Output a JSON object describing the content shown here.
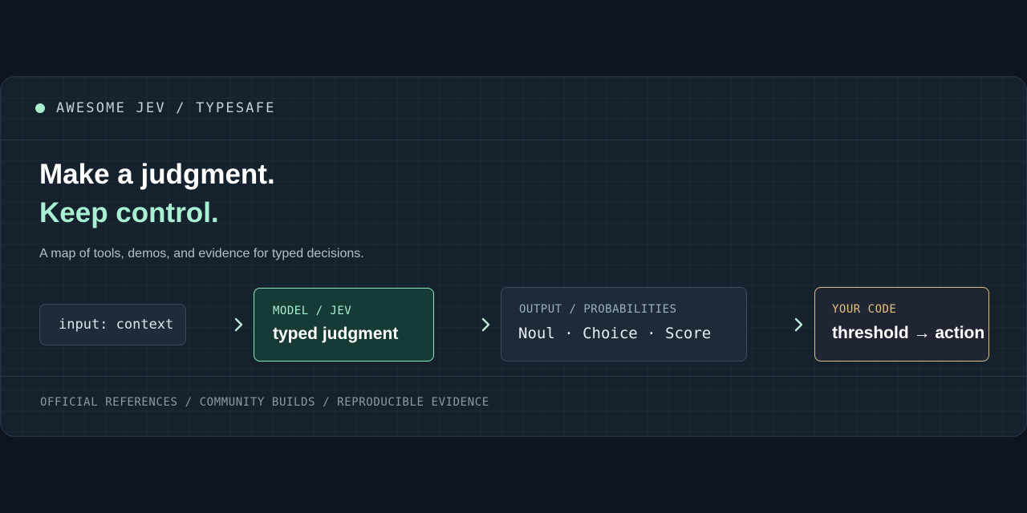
{
  "header": {
    "brand": "AWESOME JEV / TYPESAFE"
  },
  "hero": {
    "title_line1": "Make a judgment.",
    "title_line2": "Keep control.",
    "subtitle": "A map of tools, demos, and evidence for typed decisions."
  },
  "pipeline": {
    "input": {
      "text": "input: context"
    },
    "model": {
      "label": "MODEL / JEV",
      "value": "typed judgment"
    },
    "output": {
      "label": "OUTPUT / PROBABILITIES",
      "value": "Noul · Choice · Score"
    },
    "code": {
      "label": "YOUR CODE",
      "value": "threshold → action"
    }
  },
  "footer": {
    "text": "OFFICIAL REFERENCES / COMMUNITY BUILDS / REPRODUCIBLE EVIDENCE"
  },
  "colors": {
    "background": "#0e1420",
    "card": "#15212d",
    "accent_mint": "#a7f0d2",
    "accent_gold": "#d9c08a"
  },
  "icons": {
    "status": "dot-icon",
    "flow": "chevron-right-icon"
  }
}
